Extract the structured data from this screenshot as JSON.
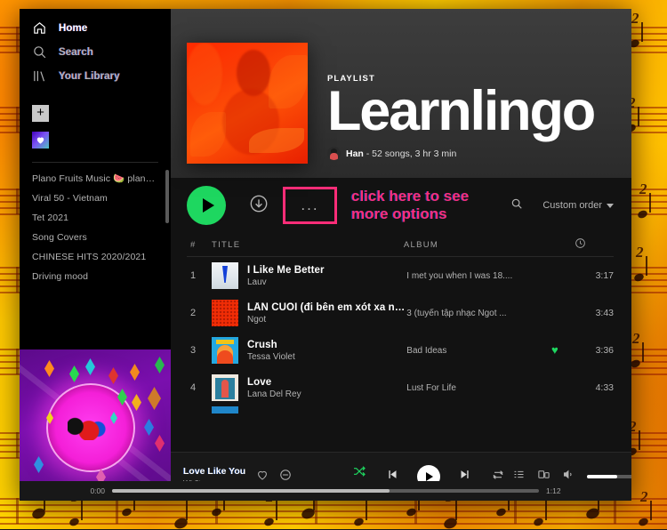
{
  "sidebar": {
    "nav": [
      {
        "label": "Home",
        "icon": "home-icon",
        "active": true
      },
      {
        "label": "Search",
        "icon": "search-icon",
        "active": false
      },
      {
        "label": "Your Library",
        "icon": "library-icon",
        "active": false
      }
    ],
    "actions": [
      {
        "label": "Create Playlist",
        "icon": "plus-icon"
      },
      {
        "label": "Liked Songs",
        "icon": "heart-icon"
      }
    ],
    "playlists": [
      "Plano Fruits Music 🍉 plano ...",
      "Viral 50 - Vietnam",
      "Tet 2021",
      "Song Covers",
      "CHINESE HITS 2020/2021",
      "Driving mood"
    ]
  },
  "hero": {
    "kicker": "PLAYLIST",
    "title": "Learnlingo",
    "owner": "Han",
    "meta": "- 52 songs, 3 hr 3 min"
  },
  "controls": {
    "play_label": "play-button",
    "download_label": "download-button",
    "more_label": "...",
    "annotation_line1": "click here to see",
    "annotation_line2": "more options",
    "search_label": "search-tracks",
    "sort_label": "Custom order"
  },
  "table": {
    "headers": {
      "num": "#",
      "title": "TITLE",
      "album": "ALBUM",
      "duration": "duration-icon"
    },
    "rows": [
      {
        "num": "1",
        "title": "I Like Me Better",
        "artist": "Lauv",
        "album": "I met you when I was 18....",
        "time": "3:17",
        "liked": false,
        "art": "art-blue"
      },
      {
        "num": "2",
        "title": "LẦN CUỐI (đi bên em xót xa người ...",
        "artist": "Ngot",
        "album": "3 (tuyển tập nhạc Ngot ...",
        "time": "3:43",
        "liked": false,
        "art": "art-red"
      },
      {
        "num": "3",
        "title": "Crush",
        "artist": "Tessa Violet",
        "album": "Bad Ideas",
        "time": "3:36",
        "liked": true,
        "art": "art-cyan"
      },
      {
        "num": "4",
        "title": "Love",
        "artist": "Lana Del Rey",
        "album": "Lust For Life",
        "time": "4:33",
        "liked": false,
        "art": "art-lana"
      }
    ]
  },
  "nowplaying": {
    "title": "Love Like You",
    "artist": "Wh?t",
    "like_icon": "heart-outline-icon",
    "block_icon": "ban-icon",
    "shuffle_icon": "shuffle-icon",
    "prev_icon": "previous-icon",
    "play_icon": "play-icon",
    "next_icon": "next-icon",
    "repeat_icon": "repeat-icon",
    "queue_icon": "queue-icon",
    "devices_icon": "devices-icon",
    "volume_icon": "volume-icon",
    "fullscreen_icon": "fullscreen-icon",
    "current_time": "0:00",
    "duration": "1:12"
  },
  "colors": {
    "spotify_green": "#1ed760",
    "annotation_pink": "#ff2d78",
    "panel_dark": "#121212",
    "sidebar_black": "#000000",
    "text_muted": "#b3b3b3"
  }
}
